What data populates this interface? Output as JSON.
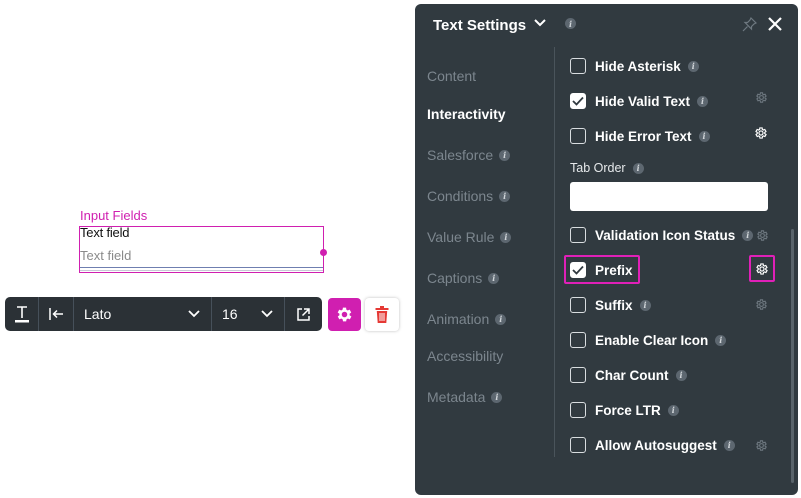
{
  "canvas": {
    "widget_title": "Input Fields",
    "field_label": "Text field",
    "field_placeholder": "Text field"
  },
  "toolbar": {
    "font_name": "Lato",
    "font_size": "16"
  },
  "panel": {
    "title": "Text Settings",
    "nav": [
      {
        "label": "Content",
        "active": false
      },
      {
        "label": "Interactivity",
        "active": true
      },
      {
        "label": "Salesforce",
        "active": false
      },
      {
        "label": "Conditions",
        "active": false
      },
      {
        "label": "Value Rule",
        "active": false
      },
      {
        "label": "Captions",
        "active": false
      },
      {
        "label": "Animation",
        "active": false
      },
      {
        "label": "Accessibility",
        "active": false
      },
      {
        "label": "Metadata",
        "active": false
      }
    ],
    "options": {
      "hide_asterisk": {
        "label": "Hide Asterisk",
        "checked": false
      },
      "hide_valid_text": {
        "label": "Hide Valid Text",
        "checked": true
      },
      "hide_error_text": {
        "label": "Hide Error Text",
        "checked": false
      },
      "validation_icon_status": {
        "label": "Validation Icon Status",
        "checked": false
      },
      "prefix": {
        "label": "Prefix",
        "checked": true
      },
      "suffix": {
        "label": "Suffix",
        "checked": false
      },
      "enable_clear_icon": {
        "label": "Enable Clear Icon",
        "checked": false
      },
      "char_count": {
        "label": "Char Count",
        "checked": false
      },
      "force_ltr": {
        "label": "Force LTR",
        "checked": false
      },
      "allow_autosuggest": {
        "label": "Allow Autosuggest",
        "checked": false
      }
    },
    "tab_order": {
      "label": "Tab Order",
      "value": ""
    }
  },
  "colors": {
    "accent": "#d01fb0",
    "panel_bg": "#313a40",
    "toolbar_bg": "#2b3136",
    "delete": "#e53935"
  }
}
